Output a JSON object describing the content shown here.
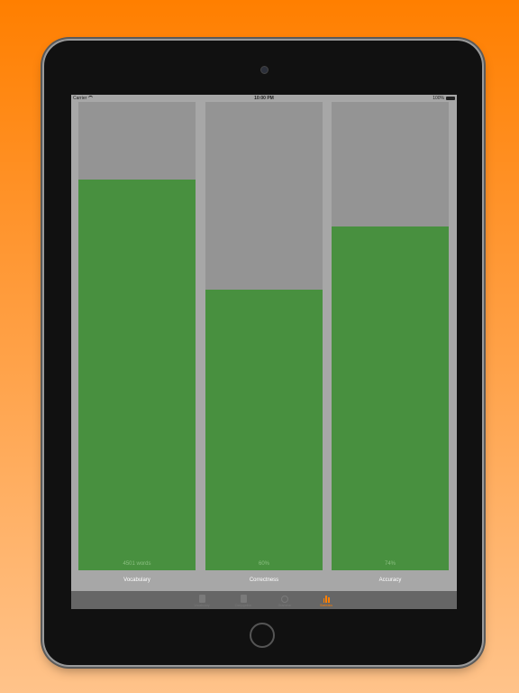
{
  "status_bar": {
    "carrier": "Carrier",
    "time": "10:00 PM",
    "battery": "100%"
  },
  "bars": [
    {
      "label": "Vocabulary",
      "value_text": "4501 words",
      "fill_fraction": 0.835
    },
    {
      "label": "Correctness",
      "value_text": "60%",
      "fill_fraction": 0.6
    },
    {
      "label": "Accuracy",
      "value_text": "74%",
      "fill_fraction": 0.735
    }
  ],
  "tab_bar": {
    "items": [
      {
        "label": "Vocabulary",
        "active": false
      },
      {
        "label": "Conjugation",
        "active": false
      },
      {
        "label": "Grammar",
        "active": false
      },
      {
        "label": "Statistics",
        "active": true
      }
    ]
  },
  "colors": {
    "background_top": "#ff7f00",
    "bar_fill": "#48903f",
    "bar_track": "#949494",
    "screen_bg": "#a7a7a7",
    "tab_active": "#ff7f00"
  }
}
